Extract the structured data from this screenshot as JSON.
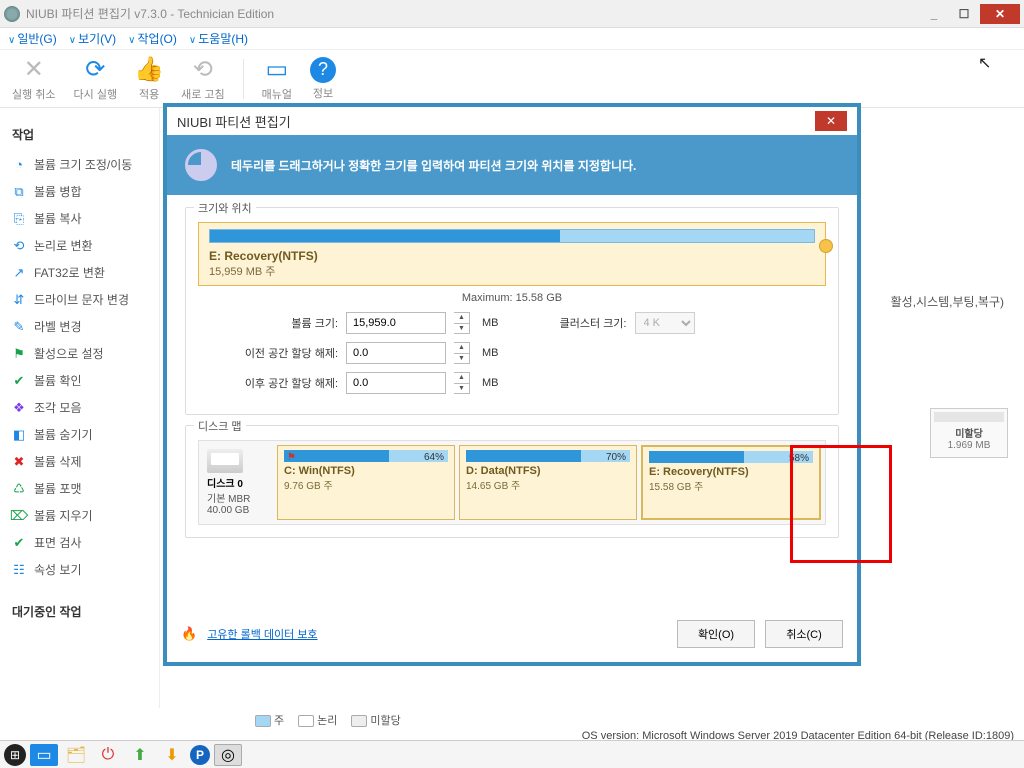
{
  "window": {
    "title": "NIUBI 파티션 편집기 v7.3.0 - Technician Edition"
  },
  "menu": {
    "general": "일반(G)",
    "view": "보기(V)",
    "work": "작업(O)",
    "help": "도움말(H)"
  },
  "toolbar": {
    "undo": "실행 취소",
    "redo": "다시 실행",
    "apply": "적용",
    "refresh": "새로 고침",
    "manual": "매뉴얼",
    "info": "정보"
  },
  "sidebar": {
    "title_ops": "작업",
    "items": [
      {
        "icon": "◔",
        "label": "볼륨 크기 조정/이동",
        "c": "#1e88e5"
      },
      {
        "icon": "⧉",
        "label": "볼륨 병합",
        "c": "#1e88e5"
      },
      {
        "icon": "⎘",
        "label": "볼륨 복사",
        "c": "#1e88e5"
      },
      {
        "icon": "⟲",
        "label": "논리로 변환",
        "c": "#1e88e5"
      },
      {
        "icon": "↗",
        "label": "FAT32로 변환",
        "c": "#1e88e5"
      },
      {
        "icon": "⇵",
        "label": "드라이브 문자 변경",
        "c": "#1e88e5"
      },
      {
        "icon": "✎",
        "label": "라벨 변경",
        "c": "#1e88e5"
      },
      {
        "icon": "⚑",
        "label": "활성으로 설정",
        "c": "#16a34a"
      },
      {
        "icon": "✔",
        "label": "볼륨 확인",
        "c": "#16a34a"
      },
      {
        "icon": "❖",
        "label": "조각 모음",
        "c": "#7c3aed"
      },
      {
        "icon": "◧",
        "label": "볼륨 숨기기",
        "c": "#1e88e5"
      },
      {
        "icon": "✖",
        "label": "볼륨 삭제",
        "c": "#dc2626"
      },
      {
        "icon": "♺",
        "label": "볼륨 포맷",
        "c": "#16a34a"
      },
      {
        "icon": "⌦",
        "label": "볼륨 지우기",
        "c": "#16a34a"
      },
      {
        "icon": "✔",
        "label": "표면 검사",
        "c": "#16a34a"
      },
      {
        "icon": "☷",
        "label": "속성 보기",
        "c": "#1e88e5"
      }
    ],
    "title_pending": "대기중인 작업"
  },
  "bg_text": "활성,시스템,부팅,복구)",
  "bg_part": {
    "name": "미할당",
    "size": "1.969 MB"
  },
  "dialog": {
    "title": "NIUBI 파티션 편집기",
    "banner": "테두리를 드래그하거나 정확한 크기를 입력하여 파티션 크기와 위치를 지정합니다.",
    "fs_size_pos": "크기와 위치",
    "slider": {
      "name": "E: Recovery(NTFS)",
      "sub": "15,959 MB 주",
      "max": "Maximum: 15.58 GB"
    },
    "form": {
      "vol_size_lbl": "볼륨 크기:",
      "vol_size_val": "15,959.0",
      "unit": "MB",
      "unalloc_before_lbl": "이전 공간 할당 해제:",
      "unalloc_before_val": "0.0",
      "unalloc_after_lbl": "이후 공간 할당 해제:",
      "unalloc_after_val": "0.0",
      "cluster_lbl": "클러스터 크기:",
      "cluster_val": "4 K"
    },
    "fs_diskmap": "디스크 맵",
    "disk": {
      "name": "디스크 0",
      "type": "기본 MBR",
      "size": "40.00 GB",
      "parts": [
        {
          "pct": "64%",
          "used": 64,
          "name": "C: Win(NTFS)",
          "size": "9.76 GB 주",
          "flag": true
        },
        {
          "pct": "70%",
          "used": 70,
          "name": "D: Data(NTFS)",
          "size": "14.65 GB 주",
          "flag": false
        },
        {
          "pct": "58%",
          "used": 58,
          "name": "E: Recovery(NTFS)",
          "size": "15.58 GB 주",
          "flag": false,
          "sel": true
        }
      ]
    },
    "rollback": "고유한 롤백 데이터 보호",
    "ok": "확인(O)",
    "cancel": "취소(C)"
  },
  "legend": {
    "primary": "주",
    "logical": "논리",
    "unalloc": "미할당"
  },
  "status": "OS version: Microsoft Windows Server 2019 Datacenter Edition  64-bit  (Release ID:1809)"
}
